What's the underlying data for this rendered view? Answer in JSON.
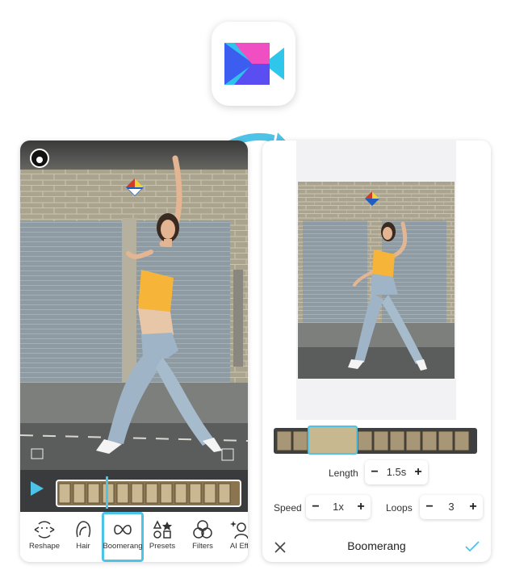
{
  "left_editor": {
    "tools": [
      {
        "label": "Reshape",
        "icon": "reshape-icon"
      },
      {
        "label": "Hair",
        "icon": "hair-icon"
      },
      {
        "label": "Boomerang",
        "icon": "boomerang-icon",
        "active": true
      },
      {
        "label": "Presets",
        "icon": "presets-icon"
      },
      {
        "label": "Filters",
        "icon": "filters-icon"
      },
      {
        "label": "AI Effe",
        "icon": "ai-effects-icon"
      }
    ]
  },
  "right_editor": {
    "length": {
      "label": "Length",
      "minus": "−",
      "value": "1.5s",
      "plus": "+"
    },
    "speed": {
      "label": "Speed",
      "minus": "−",
      "value": "1x",
      "plus": "+"
    },
    "loops": {
      "label": "Loops",
      "minus": "−",
      "value": "3",
      "plus": "+"
    },
    "bottom_bar": {
      "title": "Boomerang"
    }
  },
  "colors": {
    "accent": "#4ec3e8",
    "wall": "#a8a38e",
    "shutter": "#8d9aa1",
    "top_shirt": "#f6b438",
    "jeans": "#9fb4c6",
    "panel_bg": "#f2f2f4"
  }
}
